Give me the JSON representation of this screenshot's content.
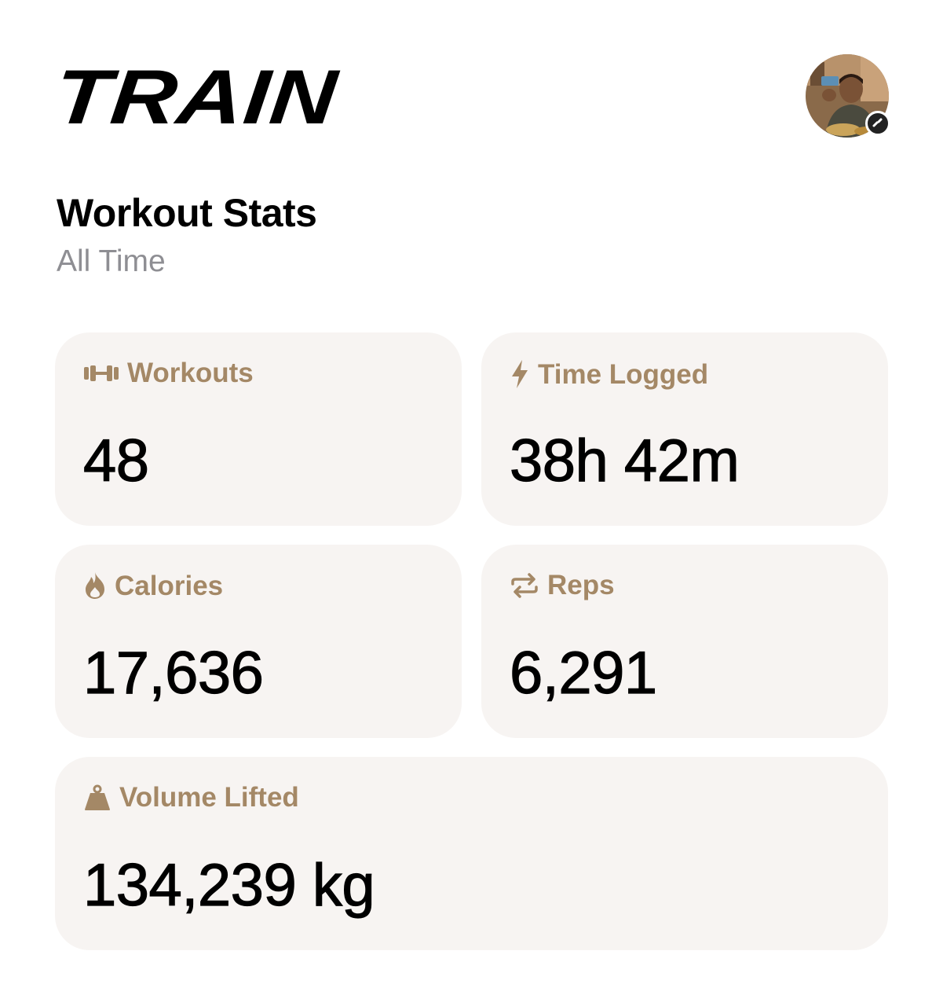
{
  "header": {
    "app_name": "TRAIN",
    "avatar_icon": "user-avatar-photo",
    "avatar_badge_icon": "link-badge-icon"
  },
  "section": {
    "title": "Workout Stats",
    "subtitle": "All Time"
  },
  "colors": {
    "card_background": "#f7f4f2",
    "label_color": "#a48866",
    "subtitle_color": "#8e8e93",
    "value_color": "#000000"
  },
  "stats": {
    "workouts": {
      "icon": "dumbbell-icon",
      "label": "Workouts",
      "value": "48"
    },
    "time_logged": {
      "icon": "lightning-bolt-icon",
      "label": "Time Logged",
      "value": "38h 42m"
    },
    "calories": {
      "icon": "flame-icon",
      "label": "Calories",
      "value": "17,636"
    },
    "reps": {
      "icon": "repeat-arrows-icon",
      "label": "Reps",
      "value": "6,291"
    },
    "volume_lifted": {
      "icon": "kettlebell-weight-icon",
      "label": "Volume Lifted",
      "value": "134,239 kg"
    }
  }
}
